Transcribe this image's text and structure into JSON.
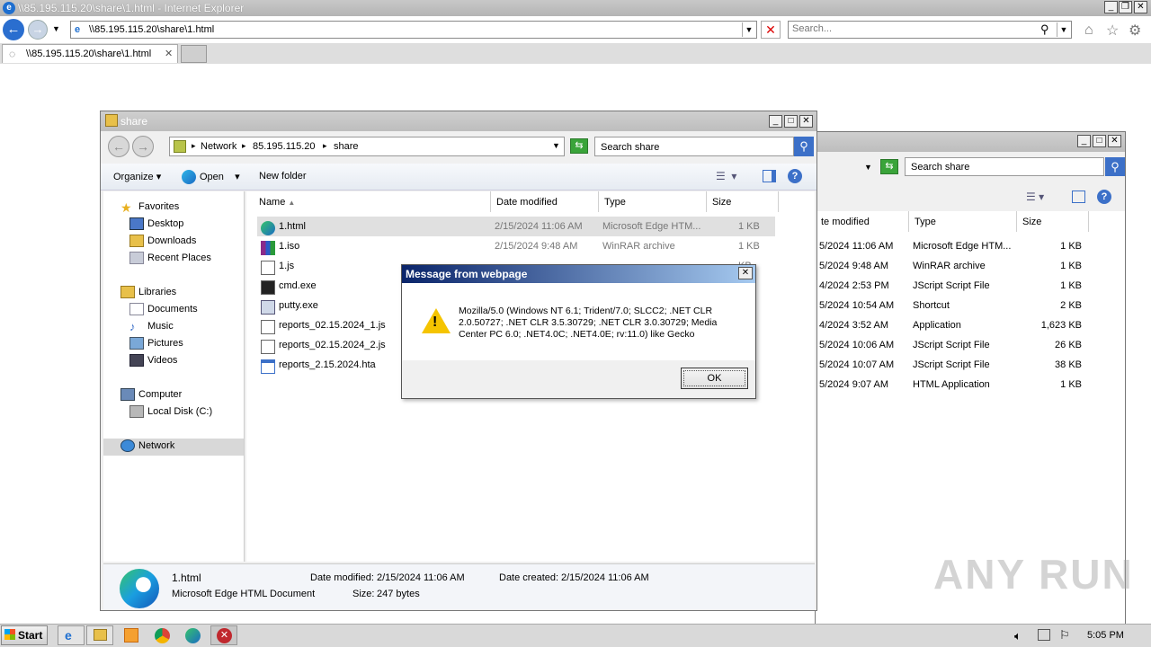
{
  "ie": {
    "title": "\\\\85.195.115.20\\share\\1.html - Internet Explorer",
    "address": "\\\\85.195.115.20\\share\\1.html",
    "search_placeholder": "Search...",
    "tab_label": "\\\\85.195.115.20\\share\\1.html"
  },
  "explorer_back": {
    "search_placeholder": "Search share",
    "columns": [
      "te modified",
      "Type",
      "Size"
    ],
    "rows": [
      {
        "date": "5/2024 11:06 AM",
        "type": "Microsoft Edge HTM...",
        "size": "1 KB"
      },
      {
        "date": "5/2024 9:48 AM",
        "type": "WinRAR archive",
        "size": "1 KB"
      },
      {
        "date": "4/2024 2:53 PM",
        "type": "JScript Script File",
        "size": "1 KB"
      },
      {
        "date": "5/2024 10:54 AM",
        "type": "Shortcut",
        "size": "2 KB"
      },
      {
        "date": "4/2024 3:52 AM",
        "type": "Application",
        "size": "1,623 KB"
      },
      {
        "date": "5/2024 10:06 AM",
        "type": "JScript Script File",
        "size": "26 KB"
      },
      {
        "date": "5/2024 10:07 AM",
        "type": "JScript Script File",
        "size": "38 KB"
      },
      {
        "date": "5/2024 9:07 AM",
        "type": "HTML Application",
        "size": "1 KB"
      }
    ]
  },
  "explorer": {
    "title": "share",
    "breadcrumb": [
      "Network",
      "85.195.115.20",
      "share"
    ],
    "search_placeholder": "Search share",
    "toolbar": {
      "organize": "Organize",
      "open": "Open",
      "new_folder": "New folder"
    },
    "columns": {
      "name": "Name",
      "date": "Date modified",
      "type": "Type",
      "size": "Size"
    },
    "nav": {
      "favorites": "Favorites",
      "desktop": "Desktop",
      "downloads": "Downloads",
      "recent": "Recent Places",
      "libraries": "Libraries",
      "documents": "Documents",
      "music": "Music",
      "pictures": "Pictures",
      "videos": "Videos",
      "computer": "Computer",
      "local_disk": "Local Disk (C:)",
      "network": "Network"
    },
    "files": [
      {
        "name": "1.html",
        "date": "2/15/2024 11:06 AM",
        "type": "Microsoft Edge HTM...",
        "size": "1 KB",
        "icon": "edge-icon"
      },
      {
        "name": "1.iso",
        "date": "2/15/2024 9:48 AM",
        "type": "WinRAR archive",
        "size": "1 KB",
        "icon": "winrar-icon"
      },
      {
        "name": "1.js",
        "date": "",
        "type": "",
        "size": "KB",
        "icon": "script-icon"
      },
      {
        "name": "cmd.exe",
        "date": "",
        "type": "",
        "size": "KB",
        "icon": "cmd-icon"
      },
      {
        "name": "putty.exe",
        "date": "",
        "type": "",
        "size": "KB",
        "icon": "putty-icon"
      },
      {
        "name": "reports_02.15.2024_1.js",
        "date": "",
        "type": "",
        "size": "KB",
        "icon": "script-icon"
      },
      {
        "name": "reports_02.15.2024_2.js",
        "date": "",
        "type": "",
        "size": "KB",
        "icon": "script-icon"
      },
      {
        "name": "reports_2.15.2024.hta",
        "date": "",
        "type": "",
        "size": "KB",
        "icon": "hta-icon"
      }
    ],
    "details": {
      "name": "1.html",
      "type": "Microsoft Edge HTML Document",
      "date_modified_label": "Date modified:",
      "date_modified": "2/15/2024 11:06 AM",
      "date_created_label": "Date created:",
      "date_created": "2/15/2024 11:06 AM",
      "size_label": "Size:",
      "size": "247 bytes"
    }
  },
  "dialog": {
    "title": "Message from webpage",
    "message": "Mozilla/5.0 (Windows NT 6.1; Trident/7.0; SLCC2; .NET CLR 2.0.50727; .NET CLR 3.5.30729; .NET CLR 3.0.30729; Media Center PC 6.0; .NET4.0C; .NET4.0E; rv:11.0) like Gecko",
    "ok": "OK"
  },
  "watermark": "ANY RUN",
  "taskbar": {
    "start": "Start",
    "time": "5:05 PM"
  }
}
